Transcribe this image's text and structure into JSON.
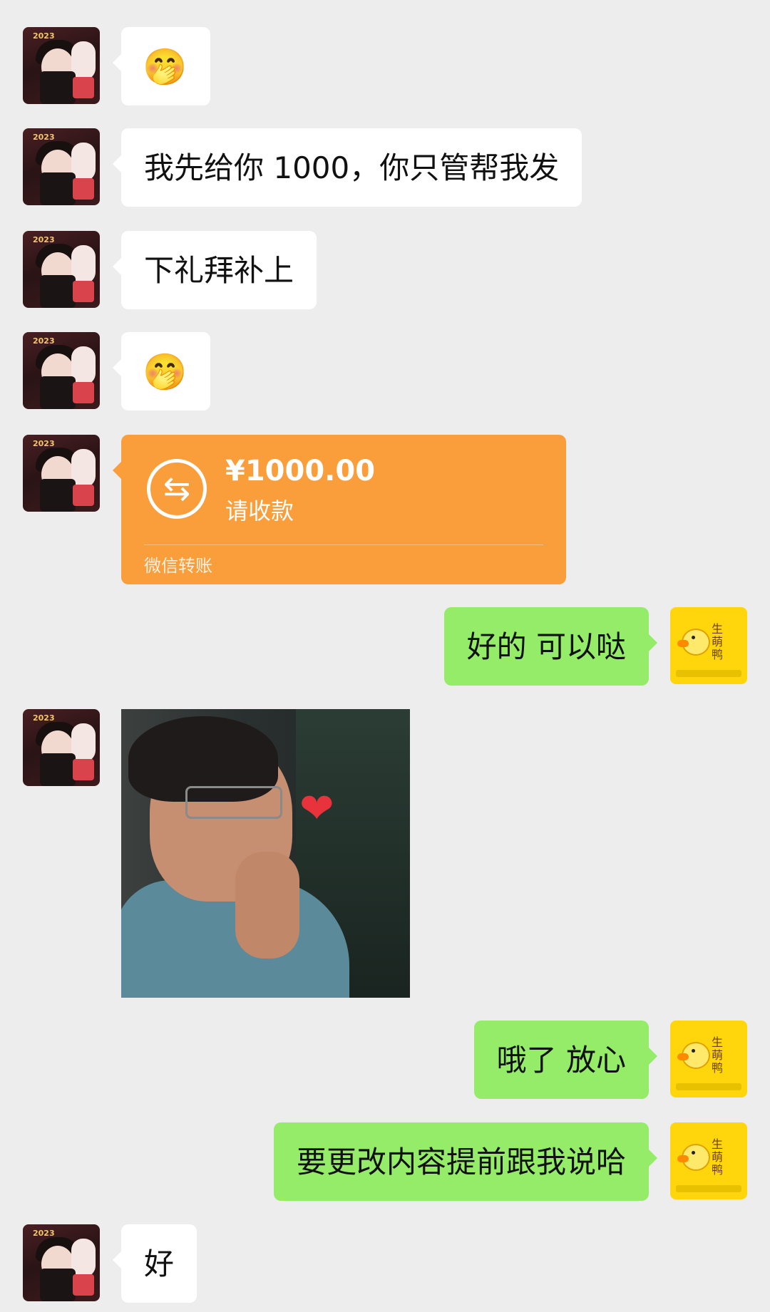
{
  "messages": [
    {
      "side": "left",
      "type": "emoji",
      "text": "🤭"
    },
    {
      "side": "left",
      "type": "text",
      "text": "我先给你 1000，你只管帮我发"
    },
    {
      "side": "left",
      "type": "text",
      "text": "下礼拜补上"
    },
    {
      "side": "left",
      "type": "emoji",
      "text": "🤭"
    },
    {
      "side": "left",
      "type": "transfer",
      "icon": "transfer-arrows-icon",
      "amount": "¥1000.00",
      "status": "请收款",
      "footer": "微信转账"
    },
    {
      "side": "right",
      "type": "text",
      "text": "好的 可以哒"
    },
    {
      "side": "left",
      "type": "image",
      "image": "man-with-glasses-heart-meme",
      "heart": "❤"
    },
    {
      "side": "right",
      "type": "text",
      "text": "哦了 放心"
    },
    {
      "side": "right",
      "type": "text",
      "text": "要更改内容提前跟我说哈"
    },
    {
      "side": "left",
      "type": "text",
      "text": "好"
    }
  ],
  "avatars": {
    "contact": {
      "year_text": "2023",
      "accent": "#d9434b"
    },
    "self": {
      "brand_text": "生萌鸭",
      "accent": "#ffd60b"
    }
  },
  "colors": {
    "background": "#ededed",
    "left_bubble": "#ffffff",
    "right_bubble": "#95ec69",
    "transfer": "#fa9d3b"
  }
}
